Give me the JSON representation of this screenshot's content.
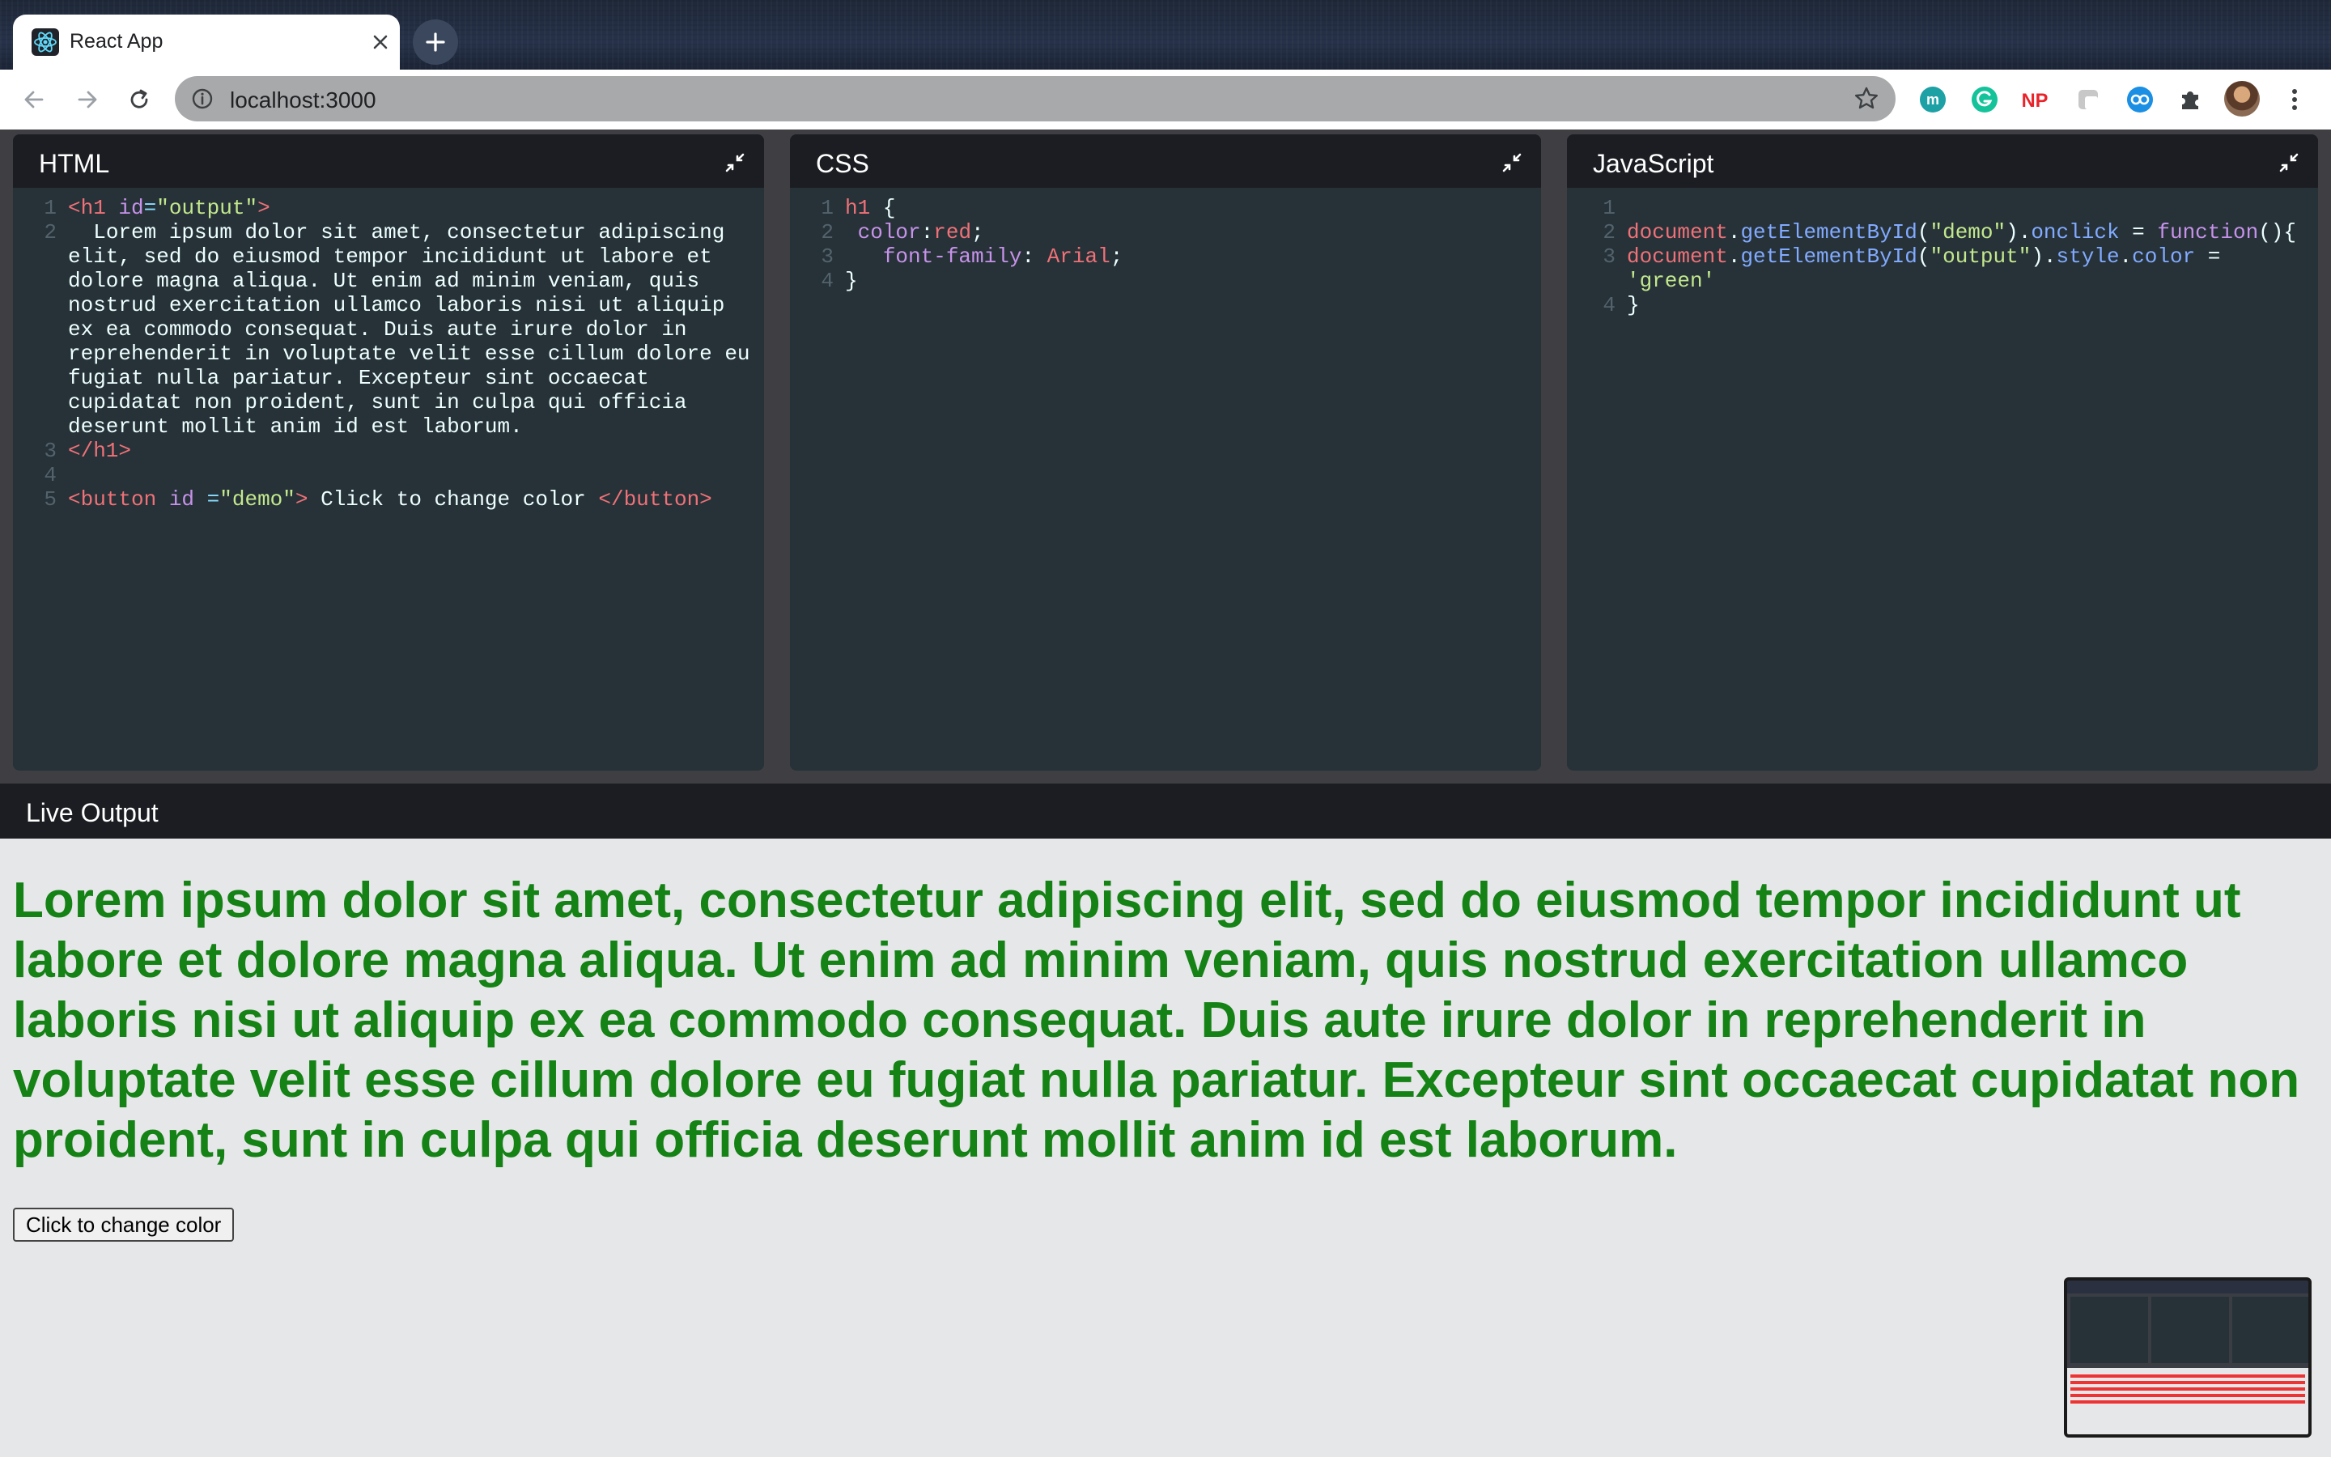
{
  "browser": {
    "tab_title": "React App",
    "url": "localhost:3000",
    "extensions": [
      "m-extension-icon",
      "grammarly-icon",
      "np-extension-icon",
      "paint-extension-icon",
      "co-extension-icon",
      "puzzle-icon"
    ],
    "extension_np_label": "NP",
    "extension_m_label": "m"
  },
  "editors": {
    "html": {
      "title": "HTML",
      "lines": [
        {
          "n": "1",
          "segments": [
            [
              "tag",
              "<h1 "
            ],
            [
              "attr",
              "id"
            ],
            [
              "punc",
              "="
            ],
            [
              "str",
              "\"output\""
            ],
            [
              "tag",
              ">"
            ]
          ]
        },
        {
          "n": "2",
          "segments": [
            [
              "text",
              "  Lorem ipsum dolor sit amet, consectetur adipiscing elit, sed do eiusmod tempor incididunt ut labore et dolore magna aliqua. Ut enim ad minim veniam, quis nostrud exercitation ullamco laboris nisi ut aliquip ex ea commodo consequat. Duis aute irure dolor in reprehenderit in voluptate velit esse cillum dolore eu fugiat nulla pariatur. Excepteur sint occaecat cupidatat non proident, sunt in culpa qui officia deserunt mollit anim id est laborum."
            ]
          ]
        },
        {
          "n": "3",
          "segments": [
            [
              "tag",
              "</h1>"
            ]
          ]
        },
        {
          "n": "4",
          "segments": [
            [
              "text",
              ""
            ]
          ]
        },
        {
          "n": "5",
          "segments": [
            [
              "tag",
              "<button "
            ],
            [
              "attr",
              "id"
            ],
            [
              "punc",
              " ="
            ],
            [
              "str",
              "\"demo\""
            ],
            [
              "tag",
              ">"
            ],
            [
              "text",
              " Click to change color "
            ],
            [
              "tag",
              "</button>"
            ]
          ]
        }
      ]
    },
    "css": {
      "title": "CSS",
      "lines": [
        {
          "n": "1",
          "segments": [
            [
              "tag",
              "h1"
            ],
            [
              "text",
              " {"
            ]
          ]
        },
        {
          "n": "2",
          "segments": [
            [
              "text",
              " "
            ],
            [
              "prop",
              "color"
            ],
            [
              "text",
              ":"
            ],
            [
              "var",
              "red"
            ],
            [
              "text",
              ";"
            ]
          ]
        },
        {
          "n": "3",
          "segments": [
            [
              "text",
              "   "
            ],
            [
              "prop",
              "font-family"
            ],
            [
              "text",
              ": "
            ],
            [
              "var",
              "Arial"
            ],
            [
              "text",
              ";"
            ]
          ]
        },
        {
          "n": "4",
          "segments": [
            [
              "text",
              "}"
            ]
          ]
        }
      ]
    },
    "js": {
      "title": "JavaScript",
      "lines": [
        {
          "n": "1",
          "segments": [
            [
              "text",
              ""
            ]
          ]
        },
        {
          "n": "2",
          "segments": [
            [
              "var",
              "document"
            ],
            [
              "text",
              "."
            ],
            [
              "fn",
              "getElementById"
            ],
            [
              "text",
              "("
            ],
            [
              "str",
              "\"demo\""
            ],
            [
              "text",
              ")."
            ],
            [
              "fn",
              "onclick"
            ],
            [
              "text",
              " = "
            ],
            [
              "kw",
              "function"
            ],
            [
              "text",
              "(){"
            ]
          ]
        },
        {
          "n": "3",
          "segments": [
            [
              "var",
              "document"
            ],
            [
              "text",
              "."
            ],
            [
              "fn",
              "getElementById"
            ],
            [
              "text",
              "("
            ],
            [
              "str",
              "\"output\""
            ],
            [
              "text",
              ")."
            ],
            [
              "fn",
              "style"
            ],
            [
              "text",
              "."
            ],
            [
              "fn",
              "color"
            ],
            [
              "text",
              " = "
            ],
            [
              "str",
              "'green'"
            ]
          ]
        },
        {
          "n": "4",
          "segments": [
            [
              "text",
              "}"
            ]
          ]
        }
      ]
    }
  },
  "output": {
    "title": "Live Output",
    "heading": "Lorem ipsum dolor sit amet, consectetur adipiscing elit, sed do eiusmod tempor incididunt ut labore et dolore magna aliqua. Ut enim ad minim veniam, quis nostrud exercitation ullamco laboris nisi ut aliquip ex ea commodo consequat. Duis aute irure dolor in reprehenderit in voluptate velit esse cillum dolore eu fugiat nulla pariatur. Excepteur sint occaecat cupidatat non proident, sunt in culpa qui officia deserunt mollit anim id est laborum.",
    "heading_color": "#148214",
    "button_label": "Click to change color"
  },
  "colors": {
    "editor_bg": "#263238",
    "header_bg": "#1b1d22",
    "output_bg": "#e6e7e9"
  }
}
